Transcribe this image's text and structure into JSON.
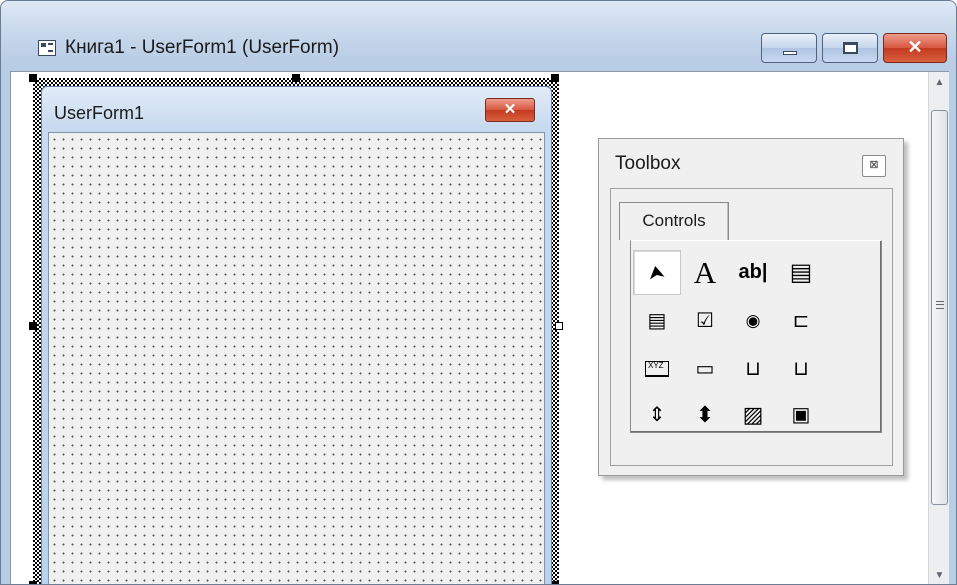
{
  "window": {
    "title": "Книга1 - UserForm1 (UserForm)",
    "minimize_icon": "minimize-icon",
    "maximize_icon": "maximize-icon",
    "close_glyph": "✕"
  },
  "userform": {
    "title": "UserForm1",
    "close_glyph": "✕"
  },
  "toolbox": {
    "title": "Toolbox",
    "close_glyph": "⊠",
    "tab_label": "Controls",
    "tools": [
      {
        "name": "select-objects-icon",
        "glyph": "➤"
      },
      {
        "name": "label-icon",
        "glyph": "A"
      },
      {
        "name": "textbox-icon",
        "glyph": "ab|"
      },
      {
        "name": "combobox-icon",
        "glyph": "▤"
      },
      {
        "name": "listbox-icon",
        "glyph": "▤"
      },
      {
        "name": "checkbox-icon",
        "glyph": "☑"
      },
      {
        "name": "optionbutton-icon",
        "glyph": "◉"
      },
      {
        "name": "togglebutton-icon",
        "glyph": "⊏"
      },
      {
        "name": "frame-icon",
        "glyph": "XYZ"
      },
      {
        "name": "commandbutton-icon",
        "glyph": "▭"
      },
      {
        "name": "tabstrip-icon",
        "glyph": "⊔"
      },
      {
        "name": "multipage-icon",
        "glyph": "⊔"
      },
      {
        "name": "scrollbar-icon",
        "glyph": "⇕"
      },
      {
        "name": "spinbutton-icon",
        "glyph": "⬍"
      },
      {
        "name": "image-icon",
        "glyph": "▨"
      },
      {
        "name": "refedit-icon",
        "glyph": "▣"
      }
    ]
  },
  "scrollbar": {
    "up_glyph": "▲",
    "down_glyph": "▼"
  }
}
